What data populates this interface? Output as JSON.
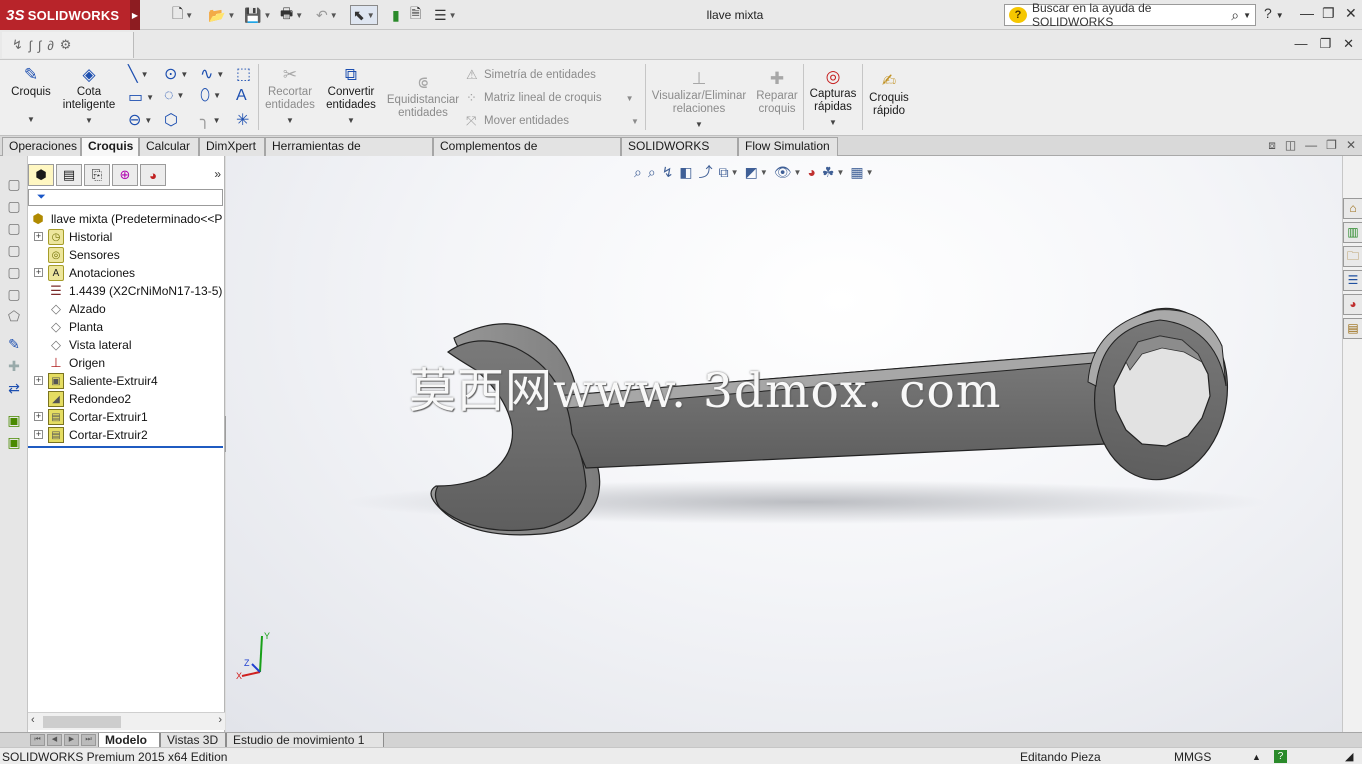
{
  "app": {
    "brand": "SOLIDWORKS",
    "brand_prefix": "3S",
    "document_title": "llave mixta",
    "help_search_placeholder": "Buscar en la ayuda de SOLIDWORKS"
  },
  "command_manager": {
    "croquis": "Croquis",
    "cota_inteligente": "Cota inteligente",
    "recortar_entidades": "Recortar entidades",
    "convertir_entidades": "Convertir entidades",
    "equidistanciar_entidades": "Equidistanciar entidades",
    "simetria_entidades": "Simetría de entidades",
    "matriz_lineal": "Matriz lineal de croquis",
    "mover_entidades": "Mover entidades",
    "visualizar_eliminar": "Visualizar/Eliminar relaciones",
    "reparar_croquis": "Reparar croquis",
    "capturas_rapidas": "Capturas rápidas",
    "croquis_rapido": "Croquis rápido"
  },
  "tabs": [
    {
      "label": "Operaciones"
    },
    {
      "label": "Croquis"
    },
    {
      "label": "Calcular"
    },
    {
      "label": "DimXpert"
    },
    {
      "label": "Herramientas de renderizado"
    },
    {
      "label": "Complementos de SOLIDWORKS"
    },
    {
      "label": "SOLIDWORKS MBD"
    },
    {
      "label": "Flow Simulation"
    }
  ],
  "feature_tree": {
    "root": "llave mixta  (Predeterminado<<P",
    "items": [
      {
        "label": "Historial"
      },
      {
        "label": "Sensores"
      },
      {
        "label": "Anotaciones"
      },
      {
        "label": "1.4439 (X2CrNiMoN17-13-5)"
      },
      {
        "label": "Alzado"
      },
      {
        "label": "Planta"
      },
      {
        "label": "Vista lateral"
      },
      {
        "label": "Origen"
      },
      {
        "label": "Saliente-Extruir4"
      },
      {
        "label": "Redondeo2"
      },
      {
        "label": "Cortar-Extruir1"
      },
      {
        "label": "Cortar-Extruir2"
      }
    ]
  },
  "viewport": {
    "watermark": "莫西网www. 3dmox. com",
    "triad": {
      "x": "X",
      "y": "Y",
      "z": "Z"
    }
  },
  "bottom_tabs": [
    {
      "label": "Modelo"
    },
    {
      "label": "Vistas 3D"
    },
    {
      "label": "Estudio de movimiento 1"
    }
  ],
  "status": {
    "edition": "SOLIDWORKS Premium 2015 x64 Edition",
    "mode": "Editando Pieza",
    "units": "MMGS"
  },
  "colors": {
    "brand_red": "#b8242a",
    "model_gray": "#6f6f6f",
    "rollback_blue": "#1f5bc1"
  }
}
